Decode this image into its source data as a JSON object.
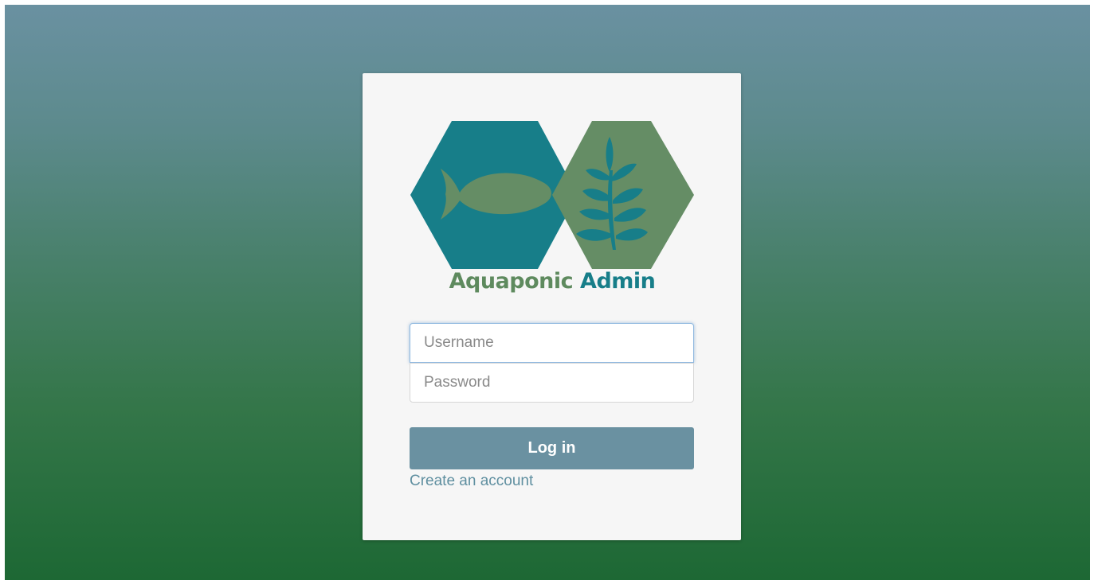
{
  "app": {
    "title_part1": "Aquaponic",
    "title_part2": "Admin"
  },
  "logo": {
    "left_icon": "fish-icon",
    "right_icon": "plant-icon",
    "colors": {
      "teal": "#177e89",
      "green": "#658d65"
    }
  },
  "form": {
    "username": {
      "placeholder": "Username",
      "value": ""
    },
    "password": {
      "placeholder": "Password",
      "value": ""
    },
    "login_label": "Log in",
    "create_account_label": "Create an account"
  },
  "colors": {
    "background_top": "#6a91a1",
    "background_bottom": "#1d6834",
    "card": "#f6f6f6",
    "button": "#6a91a1",
    "link": "#5f8fa0"
  }
}
